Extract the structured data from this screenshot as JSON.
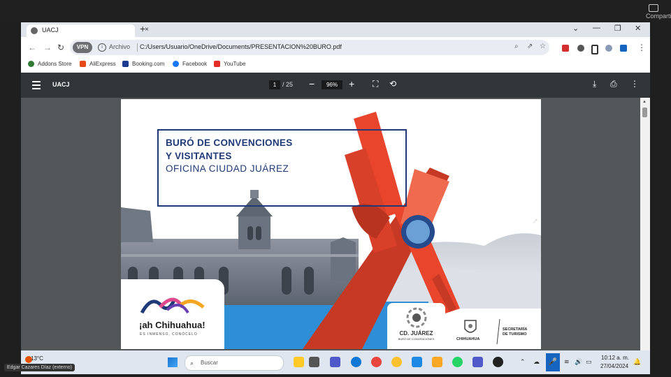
{
  "meeting": {
    "share_label": "Compartir"
  },
  "browser": {
    "tab_title": "UACJ",
    "tab_close": "×",
    "new_tab": "+",
    "window_controls": [
      "⌄",
      "—",
      "❐",
      "✕"
    ],
    "vpn_label": "VPN",
    "site_label": "Archivo",
    "url": "C:/Users/Usuario/OneDrive/Documents/PRESENTACION%20BURO.pdf",
    "bookmarks": [
      {
        "label": "Addons Store",
        "color": "#2e7d32"
      },
      {
        "label": "AliExpress",
        "color": "#e64a19"
      },
      {
        "label": "Booking.com",
        "color": "#1a3b8f"
      },
      {
        "label": "Facebook",
        "color": "#1877f2"
      },
      {
        "label": "YouTube",
        "color": "#e52d27"
      }
    ]
  },
  "pdf_toolbar": {
    "title": "UACJ",
    "current_page": "1",
    "total_pages": "/ 25",
    "zoom": "96%"
  },
  "slide": {
    "title_line1": "BURÓ DE CONVENCIONES",
    "title_line2": "Y VISITANTES",
    "title_line3": "OFICINA CIUDAD JUÁREZ",
    "logo_left_text": "¡ah Chihuahua!",
    "logo_left_sub": "ES INMENSO, CONÓCELO",
    "logo_mid_text": "CD. JUÁREZ",
    "logo_mid_sub": "BURÓ DE CONVENCIONES",
    "logo_right_left": "CHIHUAHUA",
    "logo_right_sec1": "SECRETARÍA",
    "logo_right_sec2": "DE TURISMO"
  },
  "taskbar": {
    "weather": "13°C",
    "search_placeholder": "Buscar",
    "time": "10:12 a. m.",
    "date": "27/04/2024"
  },
  "participant_name": "Edgar Cazares Díaz (externo)",
  "colors": {
    "brand_navy": "#1f3a76",
    "sculpture_red": "#e8452c",
    "pdf_bar": "#323639"
  }
}
